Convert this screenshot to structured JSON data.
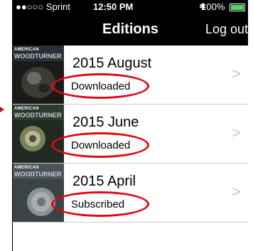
{
  "status_bar": {
    "carrier": "●●○○○ Sprint",
    "time": "12:50 PM",
    "battery": "100%"
  },
  "nav": {
    "title": "Editions",
    "logout_label": "Log out"
  },
  "cover": {
    "masthead_top": "AMERICAN",
    "masthead_bottom": "WOODTURNER"
  },
  "editions": [
    {
      "title": "2015 August",
      "status": "Downloaded"
    },
    {
      "title": "2015 June",
      "status": "Downloaded"
    },
    {
      "title": "2015 April",
      "status": "Subscribed"
    }
  ],
  "colors": {
    "annotation_red": "#e30613",
    "chevron": "#c7c7cc"
  }
}
